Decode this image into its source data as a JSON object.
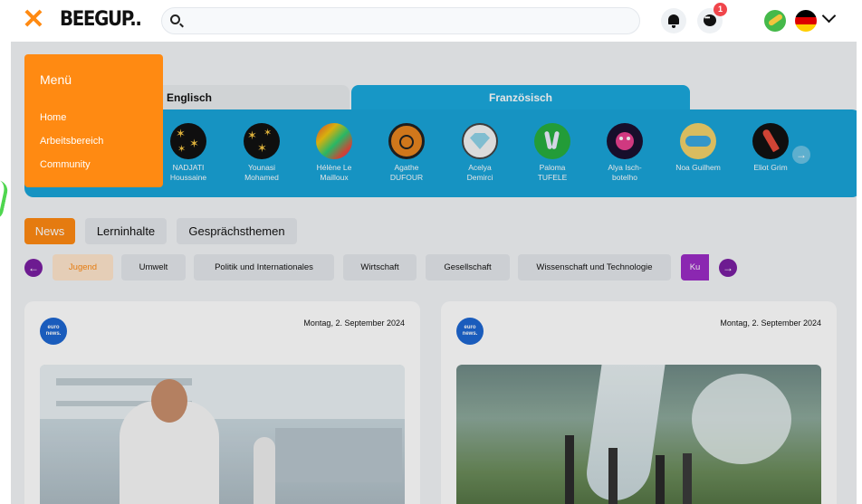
{
  "header": {
    "logo": "BEEGUP..",
    "search_placeholder": "",
    "notification_count": "1"
  },
  "menu": {
    "title": "Menü",
    "items": [
      {
        "label": "Home"
      },
      {
        "label": "Arbeitsbereich"
      },
      {
        "label": "Community"
      }
    ]
  },
  "language_tabs": [
    {
      "label": "Englisch"
    },
    {
      "label": "Französisch"
    }
  ],
  "tutors": [
    {
      "first": "NADJATI",
      "last": "Houssaine"
    },
    {
      "first": "Younasi",
      "last": "Mohamed"
    },
    {
      "first": "Hélène Le",
      "last": "Mailloux"
    },
    {
      "first": "Agathe",
      "last": "DUFOUR"
    },
    {
      "first": "Acelya",
      "last": "Demirci"
    },
    {
      "first": "Paloma",
      "last": "TUFELE"
    },
    {
      "first": "Alya Isch-",
      "last": "botelho"
    },
    {
      "first": "Noa Guilhem",
      "last": ""
    },
    {
      "first": "Eliot Grim",
      "last": ""
    }
  ],
  "content_types": [
    {
      "label": "News"
    },
    {
      "label": "Lerninhalte"
    },
    {
      "label": "Gesprächsthemen"
    }
  ],
  "categories": [
    {
      "label": "Jugend"
    },
    {
      "label": "Umwelt"
    },
    {
      "label": "Politik und Internationales"
    },
    {
      "label": "Wirtschaft"
    },
    {
      "label": "Gesellschaft"
    },
    {
      "label": "Wissenschaft und Technologie"
    },
    {
      "label": "Ku"
    }
  ],
  "cards": [
    {
      "source_logo": "euro news.",
      "date": "Montag, 2. September 2024"
    },
    {
      "source_logo": "euro news.",
      "date": "Montag, 2. September 2024"
    }
  ],
  "colors": {
    "accent_orange": "#ff8a12",
    "band_blue": "#19a4d9",
    "purple": "#7a1fa2"
  }
}
